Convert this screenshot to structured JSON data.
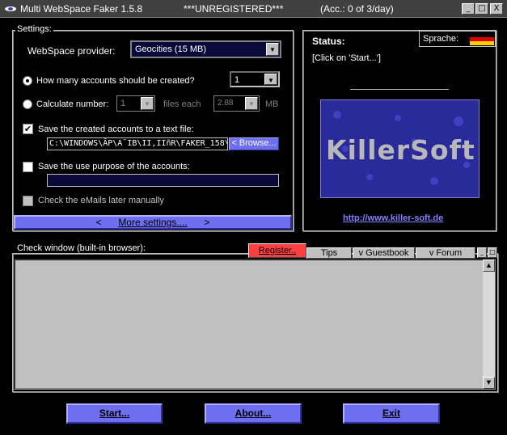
{
  "titlebar": {
    "title": "Multi WebSpace Faker 1.5.8",
    "unregistered": "***UNREGISTERED***",
    "accounts": "(Acc.: 0 of 3/day)",
    "minimize": "_",
    "maximize": "□",
    "close": "X"
  },
  "settings": {
    "group_label": "Settings:",
    "provider_label": "WebSpace provider:",
    "provider_value": "Geocities (15 MB)",
    "how_many_label": "How many accounts should be created?",
    "how_many_value": "1",
    "calc_label": "Calculate number:",
    "calc_value": "1",
    "files_each": "files each",
    "size_value": "2.88",
    "mb": "MB",
    "save_text_label": "Save the created accounts to a text file:",
    "path_value": "C:\\WINDOWS\\ÂP\\A¯IB\\II,IIñR\\FAKER_158\\/",
    "browse_label": "< Browse...",
    "save_purpose_label": "Save the use purpose of the accounts:",
    "purpose_value": "",
    "check_email_label": "Check the eMails later manually",
    "more_settings": "More settings....",
    "more_left": "<",
    "more_right": ">"
  },
  "status": {
    "title": "Status:",
    "text": "[Click on 'Start...']",
    "sprache_label": "Sprache:",
    "logo_text": "KillerSoft",
    "link": "http://www.killer-soft.de"
  },
  "check_window": {
    "label": "Check window (built-in browser):",
    "register_tab": "Register..",
    "tips_tab": "Tips",
    "guestbook_tab": "v Guestbook",
    "forum_tab": "v Forum"
  },
  "buttons": {
    "start": "Start...",
    "about": "About...",
    "exit": "Exit"
  },
  "colors": {
    "accent": "#6e6ef0",
    "register": "#ff4040",
    "link": "#8080ff"
  }
}
